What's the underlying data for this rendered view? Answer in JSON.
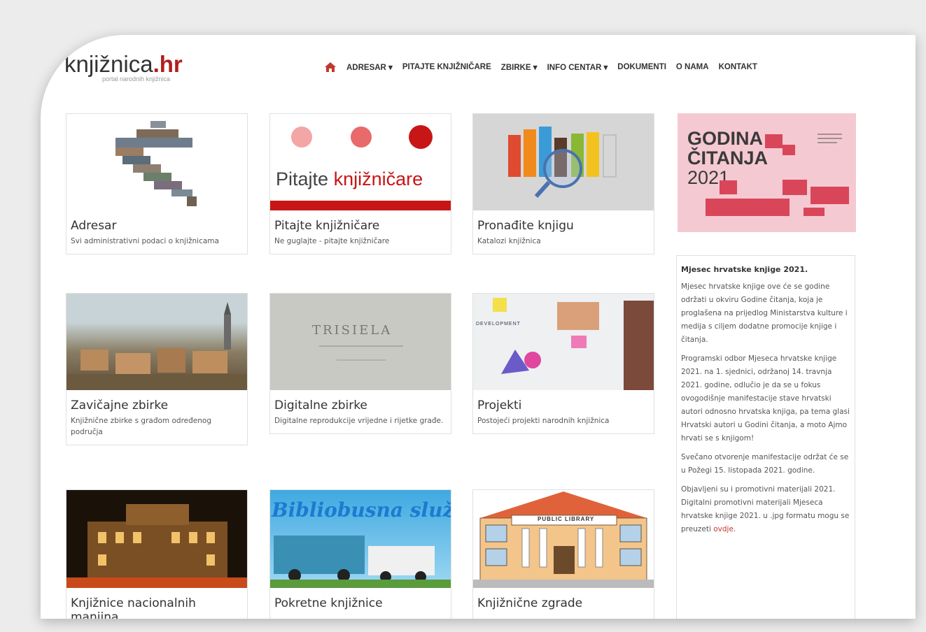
{
  "logo": {
    "main": "knjižnica",
    "suffix": ".hr",
    "sub": "portal narodnih knjižnica"
  },
  "nav": {
    "items": [
      "ADRESAR ▾",
      "PITAJTE KNJIŽNIČARE",
      "ZBIRKE ▾",
      "INFO CENTAR ▾",
      "DOKUMENTI",
      "O NAMA",
      "KONTAKT"
    ]
  },
  "cards": [
    {
      "title": "Adresar",
      "desc": "Svi administrativni podaci o knjižnicama"
    },
    {
      "title": "Pitajte knjižničare",
      "desc": "Ne guglajte - pitajte knjižničare",
      "img_text_a": "Pitajte",
      "img_text_b": "knjižničare"
    },
    {
      "title": "Pronađite knjigu",
      "desc": "Katalozi knjižnica"
    },
    {
      "title": "Zavičajne zbirke",
      "desc": "Knjižnične zbirke s građom određenog područja"
    },
    {
      "title": "Digitalne zbirke",
      "desc": "Digitalne reprodukcije vrijedne i rijetke građe.",
      "img_text": "TRISIELA"
    },
    {
      "title": "Projekti",
      "desc": "Postojeći projekti narodnih knjižnica",
      "img_text": "DEVELOPMENT"
    },
    {
      "title": "Knjižnice nacionalnih manjina",
      "desc": ""
    },
    {
      "title": "Pokretne knjižnice",
      "desc": "",
      "img_text": "Bibliobusna služba"
    },
    {
      "title": "Knjižnične zgrade",
      "desc": "",
      "img_text": "PUBLIC LIBRARY"
    }
  ],
  "banner": {
    "line1": "GODINA",
    "line2": "ČITANJA",
    "line3": "2021"
  },
  "sidebar": {
    "heading": "Mjesec hrvatske knjige 2021.",
    "p1": "Mjesec hrvatske knjige ove će se godine održati u okviru Godine čitanja, koja je proglašena na prijedlog Ministarstva kulture i medija s ciljem dodatne promocije knjige i čitanja.",
    "p2": "Programski odbor Mjeseca hrvatske knjige 2021. na 1. sjednici, održanoj 14. travnja 2021. godine, odlučio je da se u fokus ovogodišnje manifestacije stave hrvatski autori odnosno hrvatska knjiga, pa tema glasi Hrvatski autori u Godini čitanja, a moto Ajmo hrvati se s knjigom!",
    "p3": "Svečano otvorenje manifestacije održat će se u Požegi 15. listopada 2021. godine.",
    "p4": "Objavljeni su i promotivni materijali 2021. Digitalni promotivni materijali Mjeseca hrvatske knjige 2021. u .jpg formatu mogu se preuzeti",
    "p4_link": "ovdje",
    "p4_end": "."
  }
}
